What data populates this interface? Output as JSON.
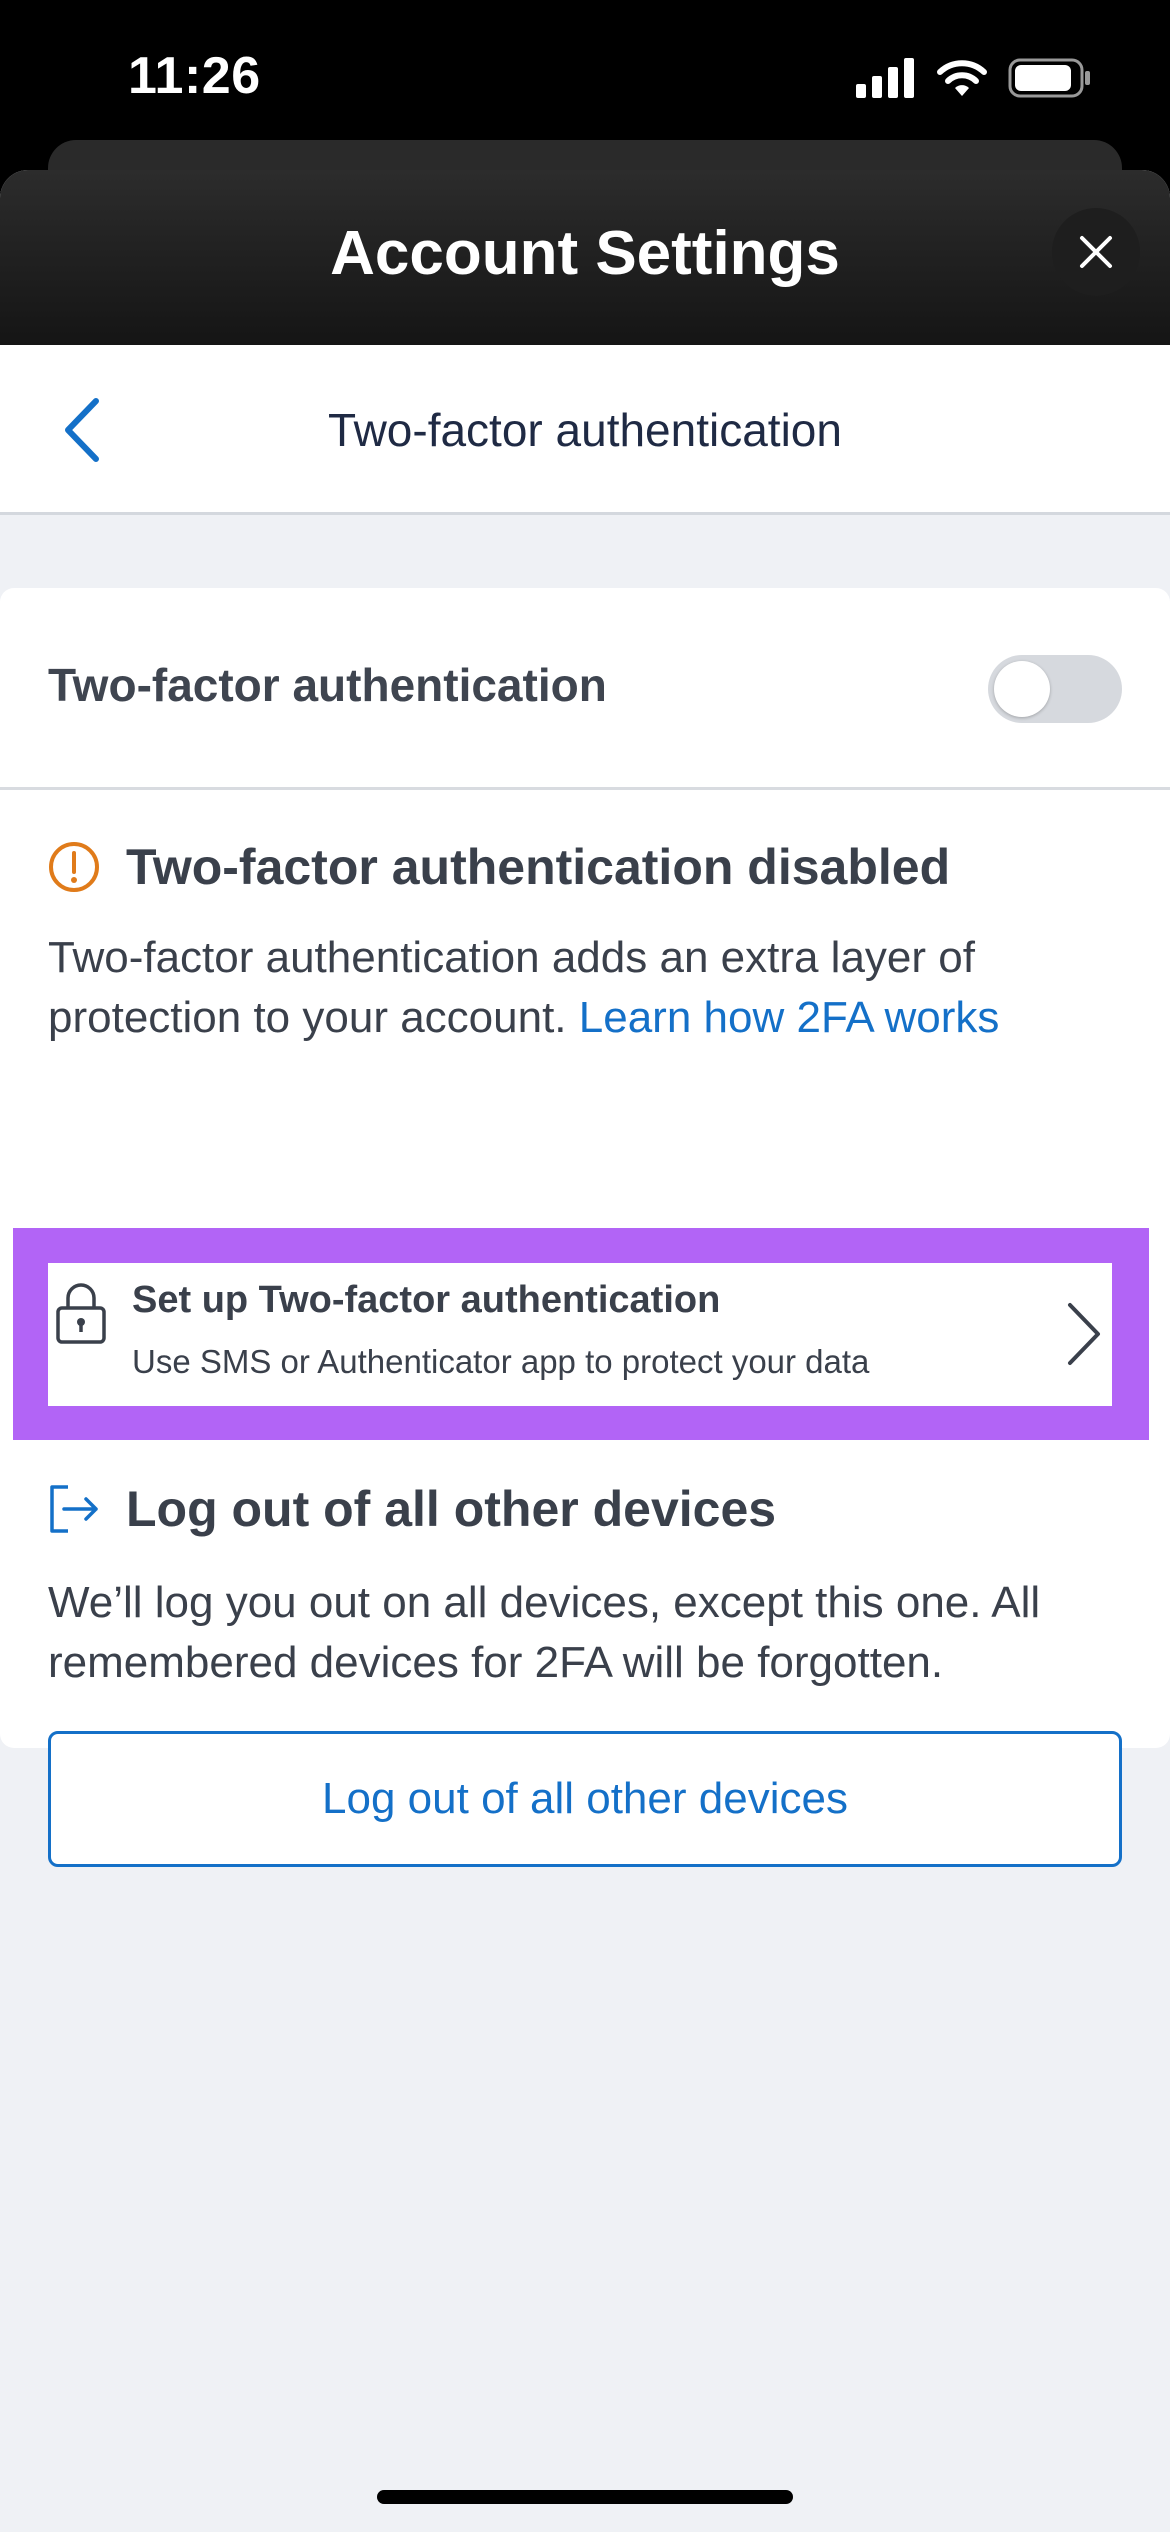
{
  "status_bar": {
    "time": "11:26"
  },
  "header": {
    "title": "Account Settings"
  },
  "nav": {
    "title": "Two-factor authentication"
  },
  "toggle_row": {
    "label": "Two-factor authentication",
    "enabled": false
  },
  "disabled_section": {
    "heading": "Two-factor authentication disabled",
    "description": "Two-factor authentication adds an extra layer of protection to your account.",
    "link_text": "Learn how 2FA works"
  },
  "setup_item": {
    "title": "Set up Two-factor authentication",
    "subtitle": "Use SMS or Authenticator app to protect your data"
  },
  "logout_section": {
    "heading": "Log out of all other devices",
    "description": "We’ll log you out on all devices, except this one. All remembered devices for 2FA will be forgotten.",
    "button_label": "Log out of all other devices"
  },
  "colors": {
    "accent": "#1470c8",
    "warning": "#e07b1a",
    "highlight": "#b264f6"
  }
}
